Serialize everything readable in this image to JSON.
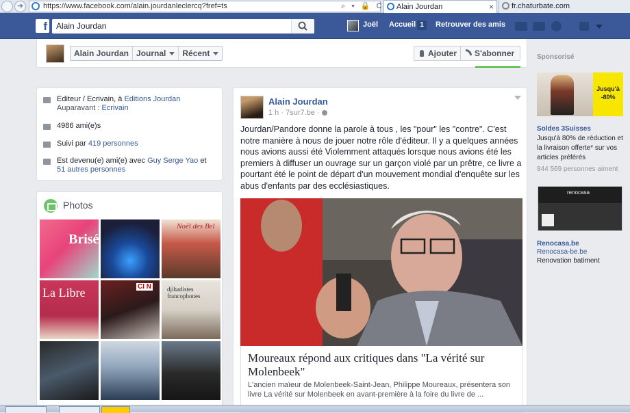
{
  "browser": {
    "url": "https://www.facebook.com/alain.jourdanleclercq?fref=ts",
    "addr_actions": "⌕ ▾ 🔒 C",
    "tabs": [
      {
        "label": "Alain Jourdan",
        "close": "×"
      },
      {
        "label": "fr.chaturbate.com"
      }
    ]
  },
  "header": {
    "logo": "f",
    "search_value": "Alain Jourdan",
    "user_name": "Joël",
    "home_label": "Accueil",
    "home_count": "1",
    "find_friends_label": "Retrouver des amis"
  },
  "timeline": {
    "name": "Alain Jourdan",
    "tab_journal": "Journal",
    "tab_recent": "Récent",
    "like_button": "Ajouter",
    "follow_button": "S'abonner"
  },
  "intro": {
    "work_prefix": "Editeur / Ecrivain, à ",
    "work_link": "Editions Jourdan",
    "previous_prefix": "Auparavant : ",
    "previous_link": "Ecrivain",
    "friends": "4986 ami(e)s",
    "followers_prefix": "Suivi par ",
    "followers_link": "419 personnes",
    "friends_with_prefix": "Est devenu(e) ami(e) avec ",
    "friends_with_link1": "Guy Serge Yao",
    "friends_with_mid": " et ",
    "friends_with_link2": "51 autres personnes"
  },
  "photos": {
    "title": "Photos",
    "captions": [
      "Brisé",
      "",
      "Noël des Bel",
      "La Libre",
      "CI N",
      "djihadistes francophones",
      "",
      "",
      ""
    ]
  },
  "post": {
    "author": "Alain Jourdan",
    "time": "1 h",
    "source": "7sur7.be",
    "text": "Jourdan/Pandore donne la parole à tous , les \"pour\" les \"contre\". C'est notre manière à nous de jouer notre rôle d'éditeur. Il y a quelques années nous avions aussi été Violemment attaqués lorsque nous avions été les premiers à diffuser un ouvrage sur un garçon violé par un prêtre, ce livre a pourtant été le point de départ d'un mouvement mondial d'enquête sur les abus d'enfants par des ecclésiastiques.",
    "link_title": "Moureaux répond aux critiques dans \"La vérité sur Molenbeek\"",
    "link_desc": "L'ancien maïeur de Molenbeek-Saint-Jean, Philippe Moureaux, présentera son livre La vérité sur Molenbeek en avant-première à la foire du livre de ..."
  },
  "sponsored": {
    "title": "Sponsorisé",
    "ad1_badge": "Jusqu'à -80%",
    "ad1_title": "Soldes 3Suisses",
    "ad1_text": "Jusqu'à 80% de réduction et la livraison offerte* sur vos articles préférés",
    "ad1_likes": "844 569 personnes aiment",
    "ad2_logo": "renocasa",
    "ad2_title": "Renocasa.be",
    "ad2_url": "Renocasa-be.be",
    "ad2_text": "Renovation batiment"
  },
  "colors": {
    "facebook_blue": "#3b5998",
    "link_blue": "#365899",
    "page_bg": "#e9ebee"
  }
}
